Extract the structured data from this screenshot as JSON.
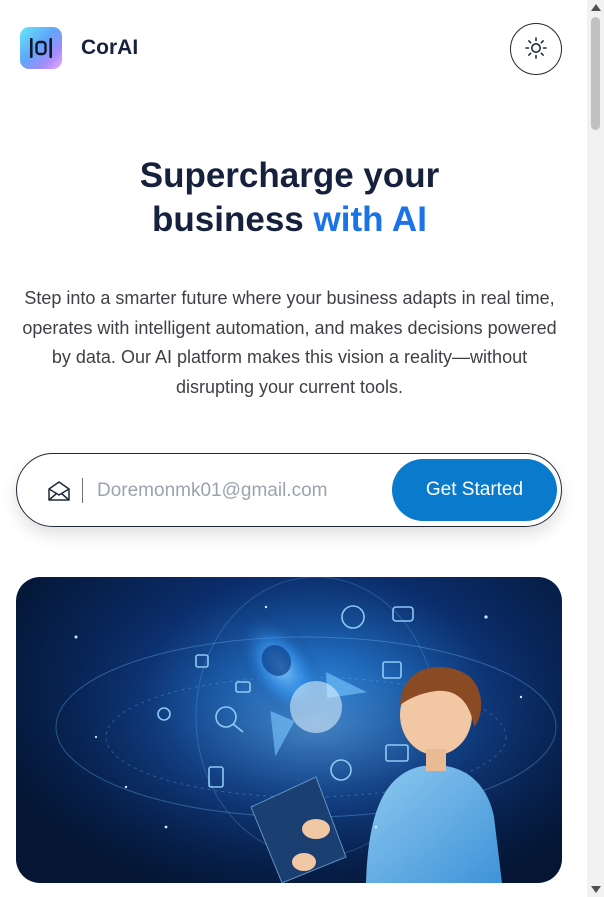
{
  "header": {
    "brand_name": "CorAI",
    "logo_icon": "corai-logo-icon",
    "theme_toggle_icon": "sun-icon"
  },
  "hero": {
    "title_line1": "Supercharge your",
    "title_line2_plain": "business",
    "title_line2_accent": "with AI",
    "description": "Step into a smarter future where your business adapts in real time, operates with intelligent automation, and makes decisions powered by data. Our AI platform makes this vision a reality—without disrupting your current tools."
  },
  "signup": {
    "mail_icon": "mail-open-icon",
    "email_placeholder": "Doremonmk01@gmail.com",
    "cta_label": "Get Started"
  },
  "colors": {
    "title": "#16213e",
    "accent": "#1a73e8",
    "cta_background": "#0a7acc",
    "body_text": "#3f3f46"
  }
}
